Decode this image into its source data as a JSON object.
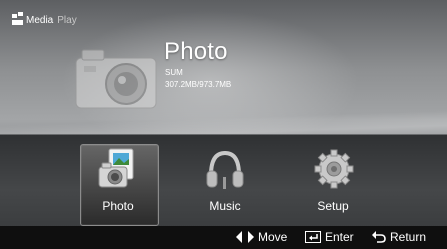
{
  "header": {
    "brand": "Media",
    "brand_suffix": "Play"
  },
  "preview": {
    "title": "Photo",
    "device": "SUM",
    "storage": "307.2MB/973.7MB"
  },
  "menu": {
    "selected_index": 0,
    "items": [
      {
        "label": "Photo",
        "icon": "photo-icon"
      },
      {
        "label": "Music",
        "icon": "music-icon"
      },
      {
        "label": "Setup",
        "icon": "setup-icon"
      }
    ]
  },
  "footer": {
    "move": "Move",
    "enter": "Enter",
    "return": "Return"
  }
}
